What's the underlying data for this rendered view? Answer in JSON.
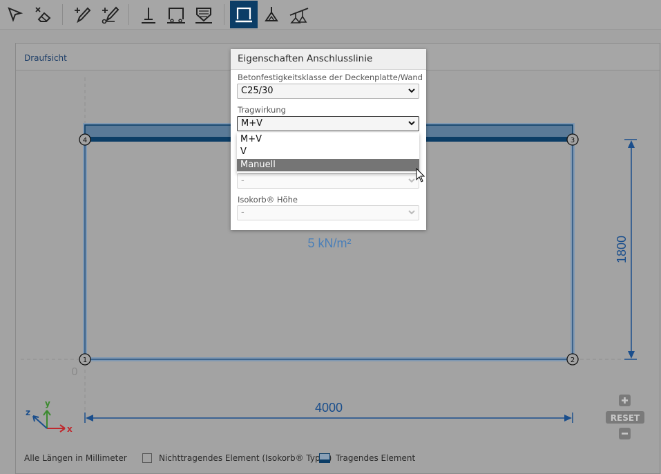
{
  "toolbar": {
    "tools": [
      {
        "name": "select-tool-icon",
        "active": false
      },
      {
        "name": "delete-tool-icon",
        "active": false
      },
      {
        "name": "draw-line-tool-icon",
        "active": false
      },
      {
        "name": "draw-node-tool-icon",
        "active": false
      },
      {
        "name": "point-support-tool-icon",
        "active": false
      },
      {
        "name": "line-support-tool-icon",
        "active": false
      },
      {
        "name": "area-support-tool-icon",
        "active": false
      },
      {
        "name": "connection-line-tool-icon",
        "active": true
      },
      {
        "name": "point-load-tool-icon",
        "active": false
      },
      {
        "name": "line-load-tool-icon",
        "active": false
      }
    ]
  },
  "view": {
    "title": "Draufsicht",
    "load_label": "5 kN/m²",
    "dimension_width": "4000",
    "dimension_height": "1800",
    "origin_label": "0",
    "nodes": [
      "1",
      "2",
      "3",
      "4"
    ],
    "axes": {
      "x": "x",
      "y": "y",
      "z": "z"
    }
  },
  "dialog": {
    "title": "Eigenschaften Anschlusslinie",
    "concrete_label": "Betonfestigkeitsklasse der Deckenplatte/Wand",
    "concrete_value": "C25/30",
    "action_label": "Tragwirkung",
    "action_value": "M+V",
    "action_options": [
      "M+V",
      "V",
      "Manuell"
    ],
    "action_highlighted": "Manuell",
    "hidden_select_value": "-",
    "height_label": "Isokorb® Höhe",
    "height_value": "-"
  },
  "zoom": {
    "reset_label": "RESET"
  },
  "legend": {
    "units": "Alle Längen in Millimeter",
    "non_load_bearing": "Nichttragendes Element (Isokorb® Typ Z)",
    "load_bearing": "Tragendes Element"
  },
  "colors": {
    "accent": "#0b3d66",
    "dimension": "#1a4e8c",
    "load_text": "#4a7fb8",
    "axis_x": "#c0282d",
    "axis_y": "#3b8a2e"
  }
}
